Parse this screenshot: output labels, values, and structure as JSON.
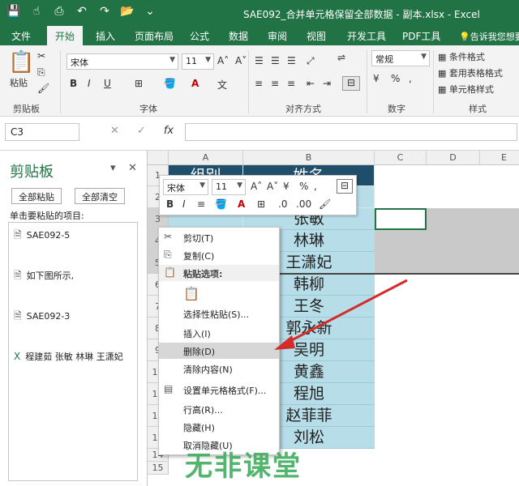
{
  "window": {
    "title": "SAE092_合并单元格保留全部数据 - 副本.xlsx - Excel"
  },
  "qat": {
    "save": "save-icon",
    "undo": "undo-icon",
    "redo": "redo-icon"
  },
  "tabs": [
    "文件",
    "开始",
    "插入",
    "页面布局",
    "公式",
    "数据",
    "审阅",
    "视图",
    "开发工具",
    "PDF工具"
  ],
  "tellme": "告诉我您想要",
  "ribbon": {
    "clipboard": {
      "paste": "粘贴",
      "label": "剪贴板"
    },
    "font": {
      "name": "宋体",
      "size": "11",
      "bold": "B",
      "italic": "I",
      "underline": "U",
      "label": "字体"
    },
    "align": {
      "label": "对齐方式"
    },
    "number": {
      "format": "常规",
      "label": "数字"
    },
    "styles": {
      "cond": "条件格式",
      "table": "套用表格格式",
      "cell": "单元格样式",
      "label": "样式"
    }
  },
  "formula": {
    "namebox": "C3",
    "fx": "fx"
  },
  "clipboard_pane": {
    "title": "剪贴板",
    "paste_all": "全部粘贴",
    "clear_all": "全部清空",
    "hint": "单击要粘贴的项目:",
    "items": [
      "SAE092-5",
      "如下图所示,",
      "SAE092-3",
      "程建茹 张敏 林琳 王潇妃"
    ]
  },
  "grid": {
    "columns": [
      "A",
      "B",
      "C",
      "D",
      "E"
    ],
    "header_row": [
      "组别",
      "姓名"
    ],
    "rows": [
      "1",
      "2",
      "3",
      "4",
      "5",
      "6",
      "7",
      "8",
      "9",
      "10",
      "11",
      "12",
      "13",
      "14",
      "15"
    ],
    "names": [
      "张敏",
      "林琳",
      "王潇妃",
      "韩柳",
      "王冬",
      "郭永新",
      "吴明",
      "黄鑫",
      "程旭",
      "赵菲菲",
      "刘松"
    ]
  },
  "mini_toolbar": {
    "font": "宋体",
    "size": "11",
    "bold": "B",
    "italic": "I"
  },
  "context_menu": {
    "cut": "剪切(T)",
    "copy": "复制(C)",
    "paste_options": "粘贴选项:",
    "paste_special": "选择性粘贴(S)...",
    "insert": "插入(I)",
    "delete": "删除(D)",
    "clear": "清除内容(N)",
    "format_cells": "设置单元格格式(F)...",
    "row_height": "行高(R)...",
    "hide": "隐藏(H)",
    "unhide": "取消隐藏(U)"
  },
  "watermark": "无非课堂",
  "colors": {
    "excel_green": "#217346",
    "name_fill": "#b7dde8",
    "header_fill": "#1f4e6b"
  }
}
